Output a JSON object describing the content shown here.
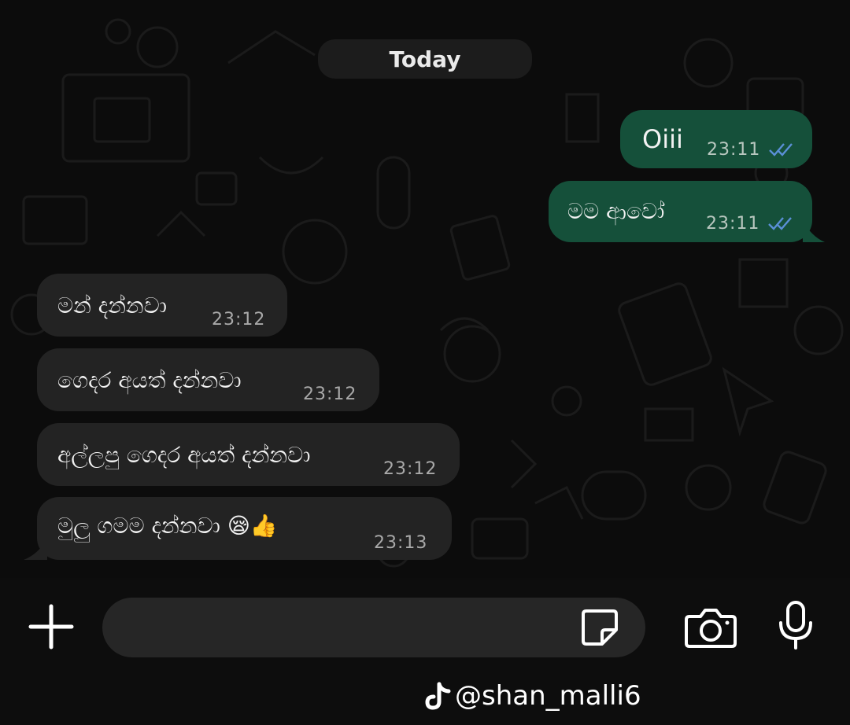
{
  "date_divider": "Today",
  "messages": [
    {
      "direction": "outgoing",
      "text": "Oiii",
      "time": "23:11",
      "status_icon": "double-check-icon",
      "status_color": "#5a8fd6"
    },
    {
      "direction": "outgoing",
      "text": "මම ආවෝ",
      "time": "23:11",
      "status_icon": "double-check-icon",
      "status_color": "#5a8fd6"
    },
    {
      "direction": "incoming",
      "text": "මන් දන්නවා",
      "time": "23:12"
    },
    {
      "direction": "incoming",
      "text": "ගෙදර අයත් දන්නවා",
      "time": "23:12"
    },
    {
      "direction": "incoming",
      "text": "අල්ලපු ගෙදර අයත් දන්නවා",
      "time": "23:12"
    },
    {
      "direction": "incoming",
      "text": "මුලු ගමම දන්නවා 😪👍",
      "time": "23:13"
    }
  ],
  "composer": {
    "attach_icon": "plus-icon",
    "sticker_icon": "sticker-icon",
    "camera_icon": "camera-icon",
    "mic_icon": "microphone-icon",
    "input_value": ""
  },
  "watermark": {
    "logo_icon": "tiktok-logo-icon",
    "handle": "@shan_malli6"
  },
  "colors": {
    "outgoing_bubble": "#15503a",
    "incoming_bubble": "#232323",
    "background": "#0c0c0c"
  }
}
